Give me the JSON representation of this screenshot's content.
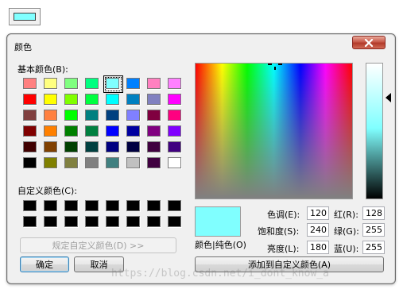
{
  "current_color_preview": {
    "color": "#80ffff"
  },
  "dialog": {
    "title": "颜色",
    "close_icon": "close-x-icon"
  },
  "basic_colors": {
    "label": "基本颜色(B):",
    "swatches": [
      "#ff8080",
      "#ffff80",
      "#80ff80",
      "#00ff80",
      "#80ffff",
      "#0080ff",
      "#ff80c0",
      "#ff80ff",
      "#ff0000",
      "#ffff00",
      "#80ff00",
      "#00ff40",
      "#00ffff",
      "#0080c0",
      "#8080c0",
      "#ff00ff",
      "#804040",
      "#ff8040",
      "#00ff00",
      "#008080",
      "#004080",
      "#8080ff",
      "#800040",
      "#ff0080",
      "#800000",
      "#ff8000",
      "#008000",
      "#008040",
      "#0000ff",
      "#0000a0",
      "#800080",
      "#8000ff",
      "#400000",
      "#804000",
      "#004000",
      "#004040",
      "#000080",
      "#000040",
      "#400040",
      "#400080",
      "#000000",
      "#808000",
      "#808040",
      "#808080",
      "#408080",
      "#c0c0c0",
      "#400040",
      "#ffffff"
    ],
    "selected_index": 4
  },
  "custom_colors": {
    "label": "自定义颜色(C):",
    "swatches": [
      "#000000",
      "#000000",
      "#000000",
      "#000000",
      "#000000",
      "#000000",
      "#000000",
      "#000000",
      "#000000",
      "#000000",
      "#000000",
      "#000000",
      "#000000",
      "#000000",
      "#000000",
      "#000000"
    ]
  },
  "buttons": {
    "define_custom": "规定自定义颜色(D) >>",
    "ok": "确定",
    "cancel": "取消",
    "add_custom": "添加到自定义颜色(A)"
  },
  "color_solid_label": "颜色|纯色(O)",
  "fields": {
    "hue": {
      "label": "色调(E):",
      "value": "120"
    },
    "sat": {
      "label": "饱和度(S):",
      "value": "240"
    },
    "lum": {
      "label": "亮度(L):",
      "value": "180"
    },
    "red": {
      "label": "红(R):",
      "value": "128"
    },
    "green": {
      "label": "绿(G):",
      "value": "255"
    },
    "blue": {
      "label": "蓝(U):",
      "value": "255"
    }
  },
  "watermark": "https://blog.csdn.net/i_dont_know_a"
}
